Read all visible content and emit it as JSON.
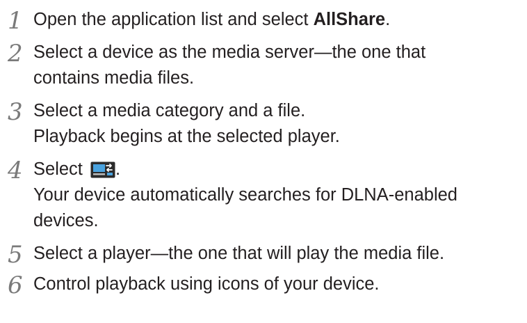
{
  "steps": [
    {
      "number": "1",
      "lines": [
        {
          "prefix": "Open the application list and select ",
          "bold": "AllShare",
          "suffix": "."
        }
      ]
    },
    {
      "number": "2",
      "lines": [
        {
          "text": "Select a device as the media server—the one that"
        },
        {
          "text": "contains media files."
        }
      ]
    },
    {
      "number": "3",
      "lines": [
        {
          "text": "Select a media category and a file."
        },
        {
          "text": "Playback begins at the selected player."
        }
      ]
    },
    {
      "number": "4",
      "lines": [
        {
          "prefix": "Select ",
          "icon": "screen-transfer-icon",
          "suffix": "."
        },
        {
          "text": "Your device automatically searches for DLNA-enabled"
        },
        {
          "text": "devices."
        }
      ]
    },
    {
      "number": "5",
      "lines": [
        {
          "text": "Select a player—the one that will play the media file."
        }
      ]
    },
    {
      "number": "6",
      "lines": [
        {
          "text": "Control playback using icons of your device."
        }
      ]
    }
  ],
  "colors": {
    "text": "#231f20",
    "step_number": "#7a7a7a",
    "icon_background": "#2b2b2b",
    "icon_screen": "#4aa3df",
    "icon_arrow": "#ffffff"
  }
}
